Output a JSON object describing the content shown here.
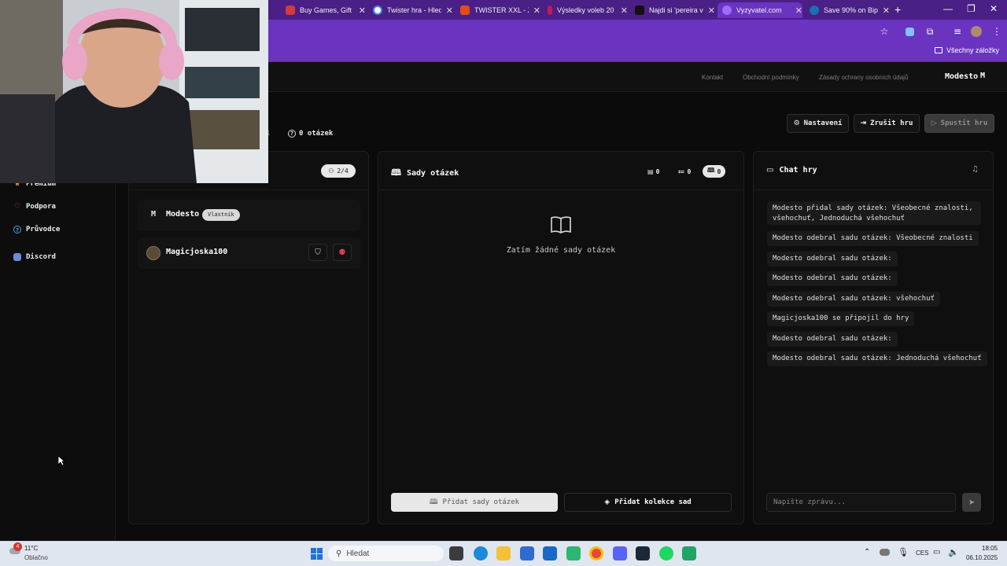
{
  "browser": {
    "tabs": [
      {
        "label": "Buy Games, Gift C",
        "color": "#d43b3b"
      },
      {
        "label": "Twister hra - Hled",
        "color": "#4285f4"
      },
      {
        "label": "TWISTER XXL - Za",
        "color": "#e64a19"
      },
      {
        "label": "Výsledky voleb 20",
        "color": "#c2185b"
      },
      {
        "label": "Najdi si 'pereira v",
        "color": "#111111"
      },
      {
        "label": "Vyzyvatel.com",
        "color": "#7c4dff",
        "active": true
      },
      {
        "label": "Save 90% on Bip",
        "color": "#1b6fb3"
      }
    ],
    "bookmarks_all": "Všechny záložky"
  },
  "header": {
    "links": [
      "Kontakt",
      "Obchodní podmínky",
      "Zásady ochrany osobních údajů"
    ],
    "user_name": "Modesto",
    "user_initial": "M"
  },
  "sidebar": {
    "items": [
      {
        "label": "Premium",
        "icon": "crown-icon"
      },
      {
        "label": "Podpora",
        "icon": "heart-icon",
        "color": "#e0445a"
      },
      {
        "label": "Průvodce",
        "icon": "help-circle-icon",
        "color": "#4aa3df"
      },
      {
        "label": "Discord",
        "icon": "discord-icon",
        "color": "#7289da"
      }
    ]
  },
  "toolbar": {
    "question_count": "0 otázek",
    "left_fragment": "1",
    "settings_label": "Nastavení",
    "cancel_label": "Zrušit hru",
    "start_label": "Spustit hru"
  },
  "players": {
    "count": "2/4",
    "list": [
      {
        "initial": "M",
        "name": "Modesto",
        "badge": "Vlastník"
      },
      {
        "name": "Magicjoska100"
      }
    ]
  },
  "sets": {
    "title": "Sady otázek",
    "stats": [
      "0",
      "0",
      "0"
    ],
    "empty_text": "Zatím žádné sady otázek",
    "add_sets_label": "Přidat sady otázek",
    "add_collection_label": "Přidat kolekce sad"
  },
  "chat": {
    "title": "Chat hry",
    "messages": [
      "Modesto přidal sady otázek: Všeobecné znalosti, všehochuť, Jednoduchá všehochuť",
      "Modesto odebral sadu otázek: Všeobecné znalosti",
      "Modesto odebral sadu otázek:",
      "Modesto odebral sadu otázek:",
      "Modesto odebral sadu otázek: všehochuť",
      "Magicjoska100 se připojil do hry",
      "Modesto odebral sadu otázek:",
      "Modesto odebral sadu otázek: Jednoduchá všehochuť"
    ],
    "input_placeholder": "Napište zprávu..."
  },
  "taskbar": {
    "weather_temp": "11°C",
    "weather_desc": "Oblačno",
    "weather_badge": "4",
    "search_placeholder": "Hledat",
    "lang": "CES",
    "time": "18:05",
    "date": "06.10.2025"
  }
}
